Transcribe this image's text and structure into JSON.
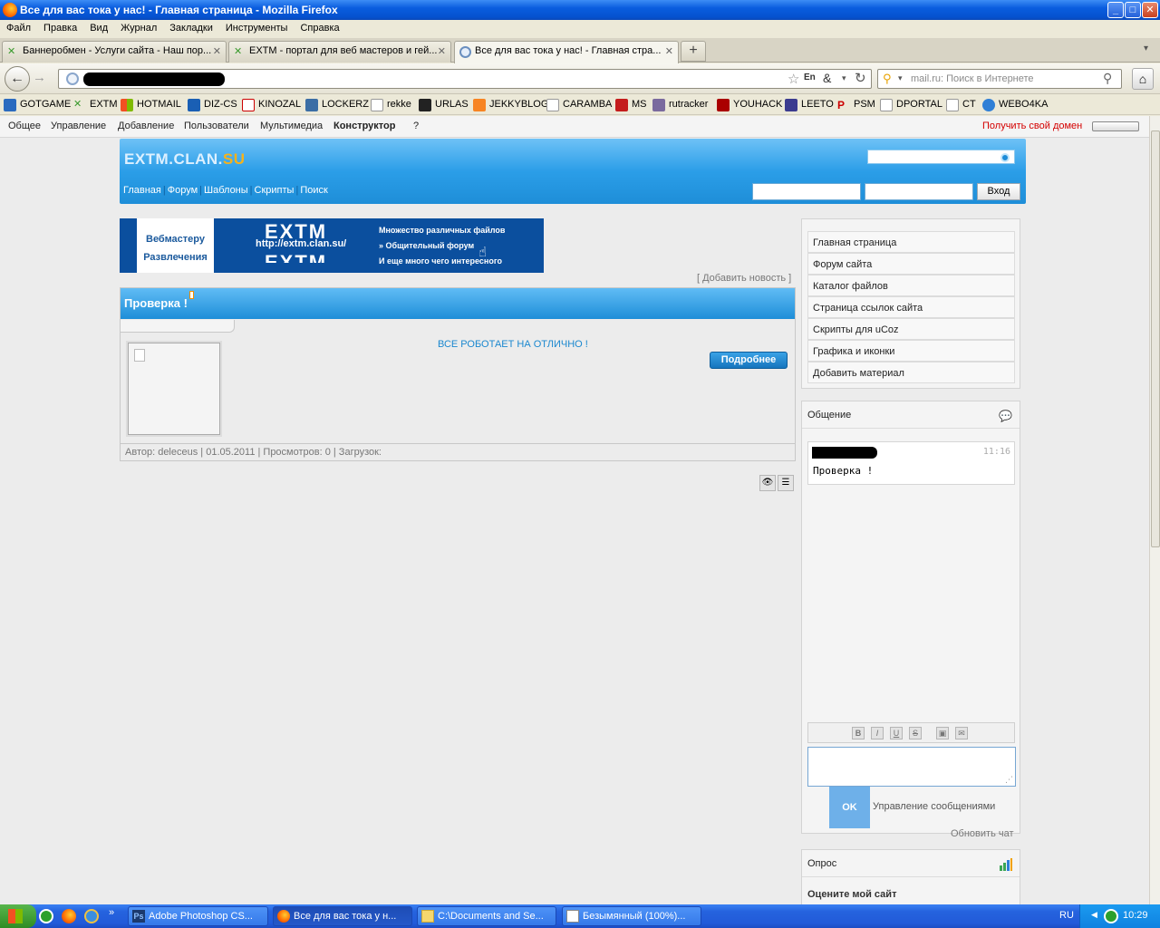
{
  "window": {
    "title": "Все для вас тока у нас! - Главная страница - Mozilla Firefox"
  },
  "menu": [
    "Файл",
    "Правка",
    "Вид",
    "Журнал",
    "Закладки",
    "Инструменты",
    "Справка"
  ],
  "tabs": [
    {
      "label": "Баннеробмен - Услуги сайта - Наш пор..."
    },
    {
      "label": "EXTM - портал для веб мастеров и гей..."
    },
    {
      "label": "Все для вас тока у нас! - Главная стра..."
    }
  ],
  "search": {
    "placeholder": "mail.ru: Поиск в Интернете"
  },
  "bookmarks": [
    "GOTGAME",
    "EXTM",
    "HOTMAIL",
    "DIZ-CS",
    "KINOZAL",
    "LOCKERZ",
    "rekke",
    "URLAS",
    "JEKKYBLOG",
    "CARAMBA",
    "MS",
    "rutracker",
    "YOUHACK",
    "LEETO",
    "PSM",
    "DPORTAL",
    "CT",
    "WEBO4KA"
  ],
  "ucoz": {
    "items": [
      "Общее",
      "Управление",
      "Добавление",
      "Пользователи",
      "Мультимедиа",
      "Конструктор",
      "?"
    ],
    "domain_link": "Получить свой домен"
  },
  "site": {
    "logo_main": "EXTM.CLAN.",
    "logo_suffix": "SU",
    "nav": [
      "Главная",
      "Форум",
      "Шаблоны",
      "Скрипты",
      "Поиск"
    ],
    "login_button": "Вход"
  },
  "banner": {
    "left_top": "Вебмастеру",
    "left_bottom": "Развлечения",
    "big": "EXTM",
    "url": "http://extm.clan.su/",
    "lines": [
      "Множество различных файлов",
      "» Общительный форум",
      "И еще много чего интересного"
    ]
  },
  "add_news": "[ Добавить новость ]",
  "news": {
    "title": "Проверка !",
    "text": "ВСЕ РОБОТАЕТ НА ОТЛИЧНО !",
    "more_button": "Подробнее",
    "footer": "Автор: deleceus | 01.05.2011 | Просмотров: 0 | Загрузок:"
  },
  "sidebar_menu": [
    "Главная страница",
    "Форум сайта",
    "Каталог файлов",
    "Страница ссылок сайта",
    "Скрипты для uCoz",
    "Графика и иконки",
    "Добавить материал"
  ],
  "chat": {
    "title": "Общение",
    "time": "11:16",
    "message": "Проверка !",
    "ok": "OK",
    "manage": "Управление сообщениями",
    "refresh": "Обновить чат"
  },
  "poll": {
    "title": "Опрос",
    "question": "Оцените мой сайт"
  },
  "taskbar": {
    "tasks": [
      "Adobe Photoshop CS...",
      "Все для вас тока у н...",
      "C:\\Documents and Se...",
      "Безымянный (100%)..."
    ],
    "lang": "RU",
    "clock": "10:29"
  }
}
